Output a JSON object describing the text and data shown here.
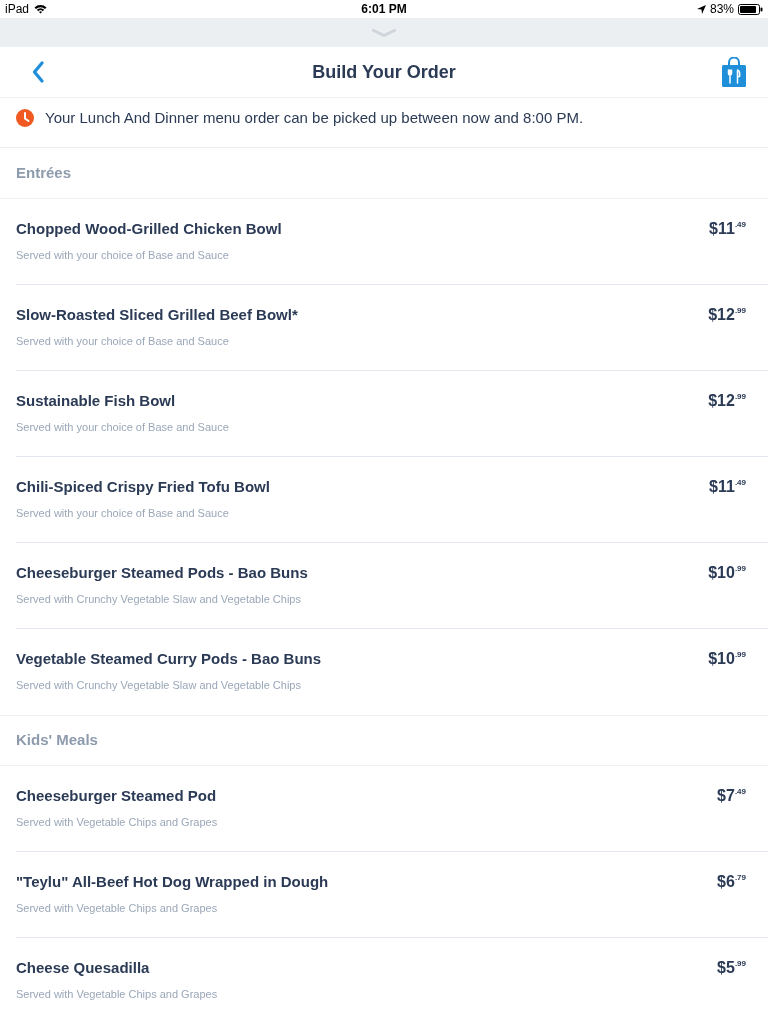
{
  "status_bar": {
    "carrier": "iPad",
    "time": "6:01 PM",
    "battery": "83%"
  },
  "nav": {
    "title": "Build Your Order"
  },
  "notice": {
    "text": "Your Lunch And Dinner menu order can be picked up between now and 8:00 PM."
  },
  "sections": [
    {
      "title": "Entrées",
      "items": [
        {
          "name": "Chopped Wood-Grilled Chicken Bowl",
          "description": "Served with your choice of Base and Sauce",
          "price": "$11$^{.49}$"
        },
        {
          "name": "Slow-Roasted Sliced Grilled Beef Bowl*",
          "description": "Served with your choice of Base and Sauce",
          "price": "$12$^{.99}$"
        },
        {
          "name": "Sustainable Fish Bowl",
          "description": "Served with your choice of Base and Sauce",
          "price": "$12$^{.99}$"
        },
        {
          "name": "Chili-Spiced Crispy Fried Tofu Bowl",
          "description": "Served with your choice of Base and Sauce",
          "price": "$11$^{.49}$"
        },
        {
          "name": "Cheeseburger Steamed Pods - Bao Buns",
          "description": "Served with Crunchy Vegetable Slaw and Vegetable Chips",
          "price": "$10$^{.99}$"
        },
        {
          "name": "Vegetable Steamed Curry Pods - Bao Buns",
          "description": "Served with Crunchy Vegetable Slaw and Vegetable Chips",
          "price": "$10$^{.99}$"
        }
      ]
    },
    {
      "title": "Kids' Meals",
      "items": [
        {
          "name": "Cheeseburger Steamed Pod",
          "description": "Served with Vegetable Chips and Grapes",
          "price": "$7$^{.49}$"
        },
        {
          "name": "\"Teylu\" All-Beef Hot Dog Wrapped in Dough",
          "description": "Served with Vegetable Chips and Grapes",
          "price": "$6$^{.79}$"
        },
        {
          "name": "Cheese Quesadilla",
          "description": "Served with Vegetable Chips and Grapes",
          "price": "$5$^{.99}$"
        }
      ]
    }
  ]
}
